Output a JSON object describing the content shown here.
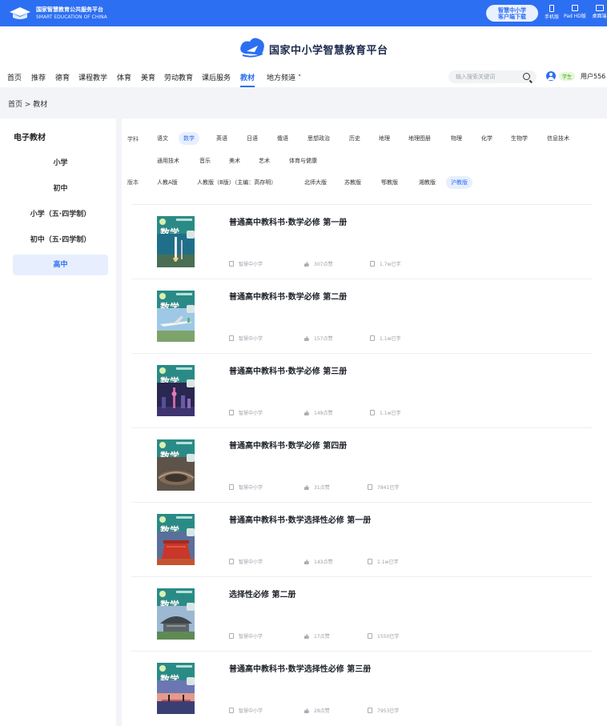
{
  "topbar": {
    "org_cn": "国家智慧教育公共服务平台",
    "org_en": "SMART EDUCATION OF CHINA",
    "download_line1": "智慧中小学",
    "download_line2": "客户端下载",
    "devices": [
      "手机版",
      "Pad HD版",
      "桌面端"
    ]
  },
  "brand": {
    "title": "国家中小学智慧教育平台"
  },
  "nav": {
    "items": [
      "首页",
      "推荐",
      "德育",
      "课程教学",
      "体育",
      "美育",
      "劳动教育",
      "课后服务",
      "教材",
      "地方频道 ˅"
    ],
    "active_index": 8,
    "search_placeholder": "输入搜索关键词",
    "user_role": "学生",
    "user_name": "用户556"
  },
  "breadcrumb": "首页 > 教材",
  "sidebar": {
    "heading": "电子教材",
    "items": [
      "小学",
      "初中",
      "小学（五·四学制）",
      "初中（五·四学制）",
      "高中"
    ],
    "active_index": 4
  },
  "filters": {
    "subject_label": "学科",
    "subjects_row1": [
      "语文",
      "数学",
      "英语",
      "日语",
      "俄语",
      "思想政治",
      "历史",
      "地理",
      "地理图册",
      "物理",
      "化学",
      "生物学",
      "信息技术"
    ],
    "subjects_row2": [
      "通用技术",
      "音乐",
      "美术",
      "艺术",
      "体育与健康"
    ],
    "subject_active": "数学",
    "edition_label": "版本",
    "editions": [
      "人教A版",
      "人教版（B版）（主编：高存明）",
      "北师大版",
      "苏教版",
      "鄂教版",
      "湘教版",
      "沪教版"
    ],
    "edition_active": "沪教版"
  },
  "books": [
    {
      "title": "普通高中教科书·数学必修 第一册",
      "cover_title": "数学",
      "publisher": "智慧中小学",
      "likes": "307点赞",
      "views": "1.7w已学",
      "scene": "rocket"
    },
    {
      "title": "普通高中教科书·数学必修 第二册",
      "cover_title": "数学",
      "publisher": "智慧中小学",
      "likes": "157点赞",
      "views": "1.1w已学",
      "scene": "plane"
    },
    {
      "title": "普通高中教科书·数学必修 第三册",
      "cover_title": "数学",
      "publisher": "智慧中小学",
      "likes": "149点赞",
      "views": "1.1w已学",
      "scene": "city"
    },
    {
      "title": "普通高中教科书·数学必修 第四册",
      "cover_title": "数学",
      "publisher": "智慧中小学",
      "likes": "31点赞",
      "views": "7841已学",
      "scene": "stadium"
    },
    {
      "title": "普通高中教科书·数学选择性必修 第一册",
      "cover_title": "数学",
      "publisher": "智慧中小学",
      "likes": "143点赞",
      "views": "1.1w已学",
      "scene": "pavilion"
    },
    {
      "title": "选择性必修 第二册",
      "cover_title": "数学",
      "publisher": "智慧中小学",
      "likes": "17点赞",
      "views": "1550已学",
      "scene": "museum"
    },
    {
      "title": "普通高中教科书·数学选择性必修 第三册",
      "cover_title": "数学",
      "publisher": "智慧中小学",
      "likes": "28点赞",
      "views": "7953已学",
      "scene": "sunset"
    }
  ]
}
